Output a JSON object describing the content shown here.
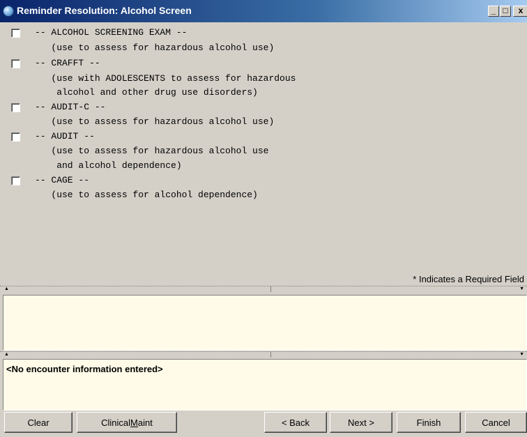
{
  "window": {
    "title": "Reminder Resolution: Alcohol Screen",
    "controls": {
      "minimize": "_",
      "maximize": "□",
      "close": "x"
    }
  },
  "items": [
    {
      "checked": false,
      "lines": [
        "-- ALCOHOL SCREENING EXAM --",
        "   (use to assess for hazardous alcohol use)"
      ]
    },
    {
      "checked": false,
      "lines": [
        "-- CRAFFT --",
        "   (use with ADOLESCENTS to assess for hazardous",
        "    alcohol and other drug use disorders)"
      ]
    },
    {
      "checked": false,
      "lines": [
        "-- AUDIT-C --",
        "   (use to assess for hazardous alcohol use)"
      ]
    },
    {
      "checked": false,
      "lines": [
        "-- AUDIT --",
        "   (use to assess for hazardous alcohol use",
        "    and alcohol dependence)"
      ]
    },
    {
      "checked": false,
      "lines": [
        "-- CAGE --",
        "   (use to assess for alcohol dependence)"
      ]
    }
  ],
  "required_note": "* Indicates a Required Field",
  "encounter_text": "<No encounter information entered>",
  "buttons": {
    "clear": "Clear",
    "clinical_maint_prefix": "Clinical ",
    "clinical_maint_underline": "M",
    "clinical_maint_suffix": "aint",
    "back": "< Back",
    "next": "Next >",
    "finish": "Finish",
    "cancel": "Cancel"
  }
}
